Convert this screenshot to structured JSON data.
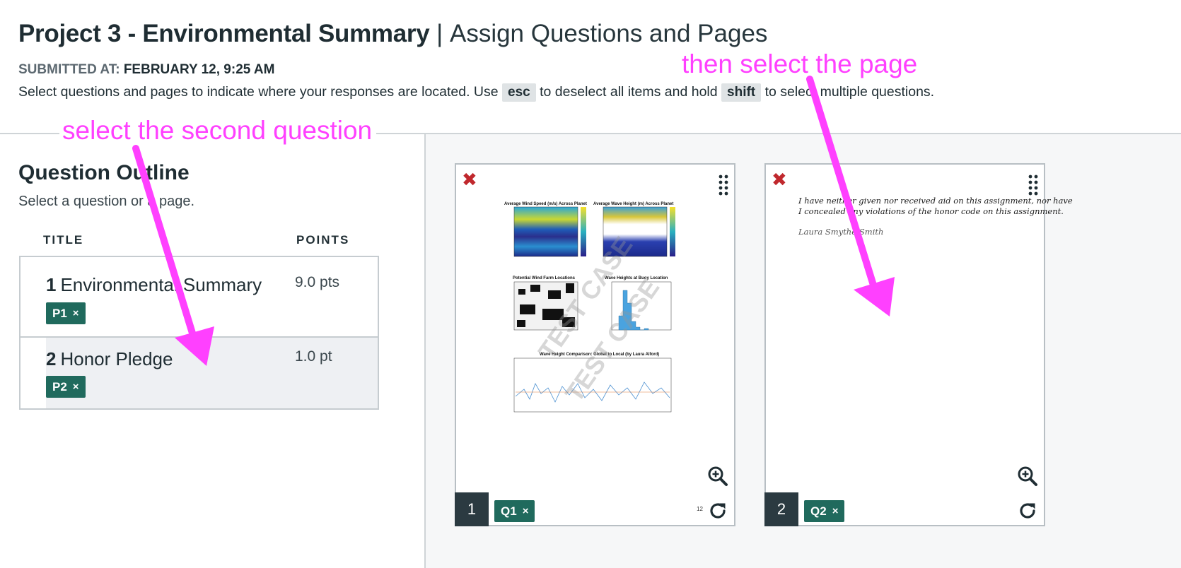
{
  "header": {
    "title_bold": "Project 3 - Environmental Summary",
    "title_separator": "|",
    "title_light": "Assign Questions and Pages",
    "submitted_label": "SUBMITTED AT:",
    "submitted_value": "FEBRUARY 12, 9:25 AM",
    "instructions": {
      "part1": "Select questions and pages to indicate where your responses are located. Use",
      "key1": "esc",
      "part2": "to deselect all items and hold",
      "key2": "shift",
      "part3": "to select multiple questions."
    }
  },
  "outline": {
    "title": "Question Outline",
    "subtitle": "Select a question or a page.",
    "columns": {
      "title": "TITLE",
      "points": "POINTS"
    },
    "questions": [
      {
        "number": "1",
        "name": "Environmental Summary",
        "points": "9.0 pts",
        "page_tag": "P1",
        "remove": "×"
      },
      {
        "number": "2",
        "name": "Honor Pledge",
        "points": "1.0 pt",
        "page_tag": "P2",
        "remove": "×"
      }
    ]
  },
  "pages": [
    {
      "number": "1",
      "question_tag": "Q1",
      "remove": "×",
      "page_note": "12",
      "thumbnail": {
        "chart_titles": [
          "Average Wind Speed (m/s) Across Planet",
          "Average Wave Height (m) Across Planet",
          "Potential Wind Farm Locations",
          "Wave Heights at Buoy Location",
          "Wave Height Comparison: Global to Local (by Laura Alford)"
        ],
        "watermark": "TEST CASE"
      }
    },
    {
      "number": "2",
      "question_tag": "Q2",
      "remove": "×",
      "pledge_line1": "I have neither given nor received aid on this assignment, nor have",
      "pledge_line2": "I concealed any violations of the honor code on this assignment.",
      "signature": "Laura Smythe-Smith"
    }
  ],
  "annotations": {
    "first": "select the second question",
    "second": "then select the page",
    "color": "#ff40ff"
  },
  "colors": {
    "tag_green": "#206a5d",
    "remove_red": "#c0282d",
    "page_number_bg": "#2b3a41"
  }
}
